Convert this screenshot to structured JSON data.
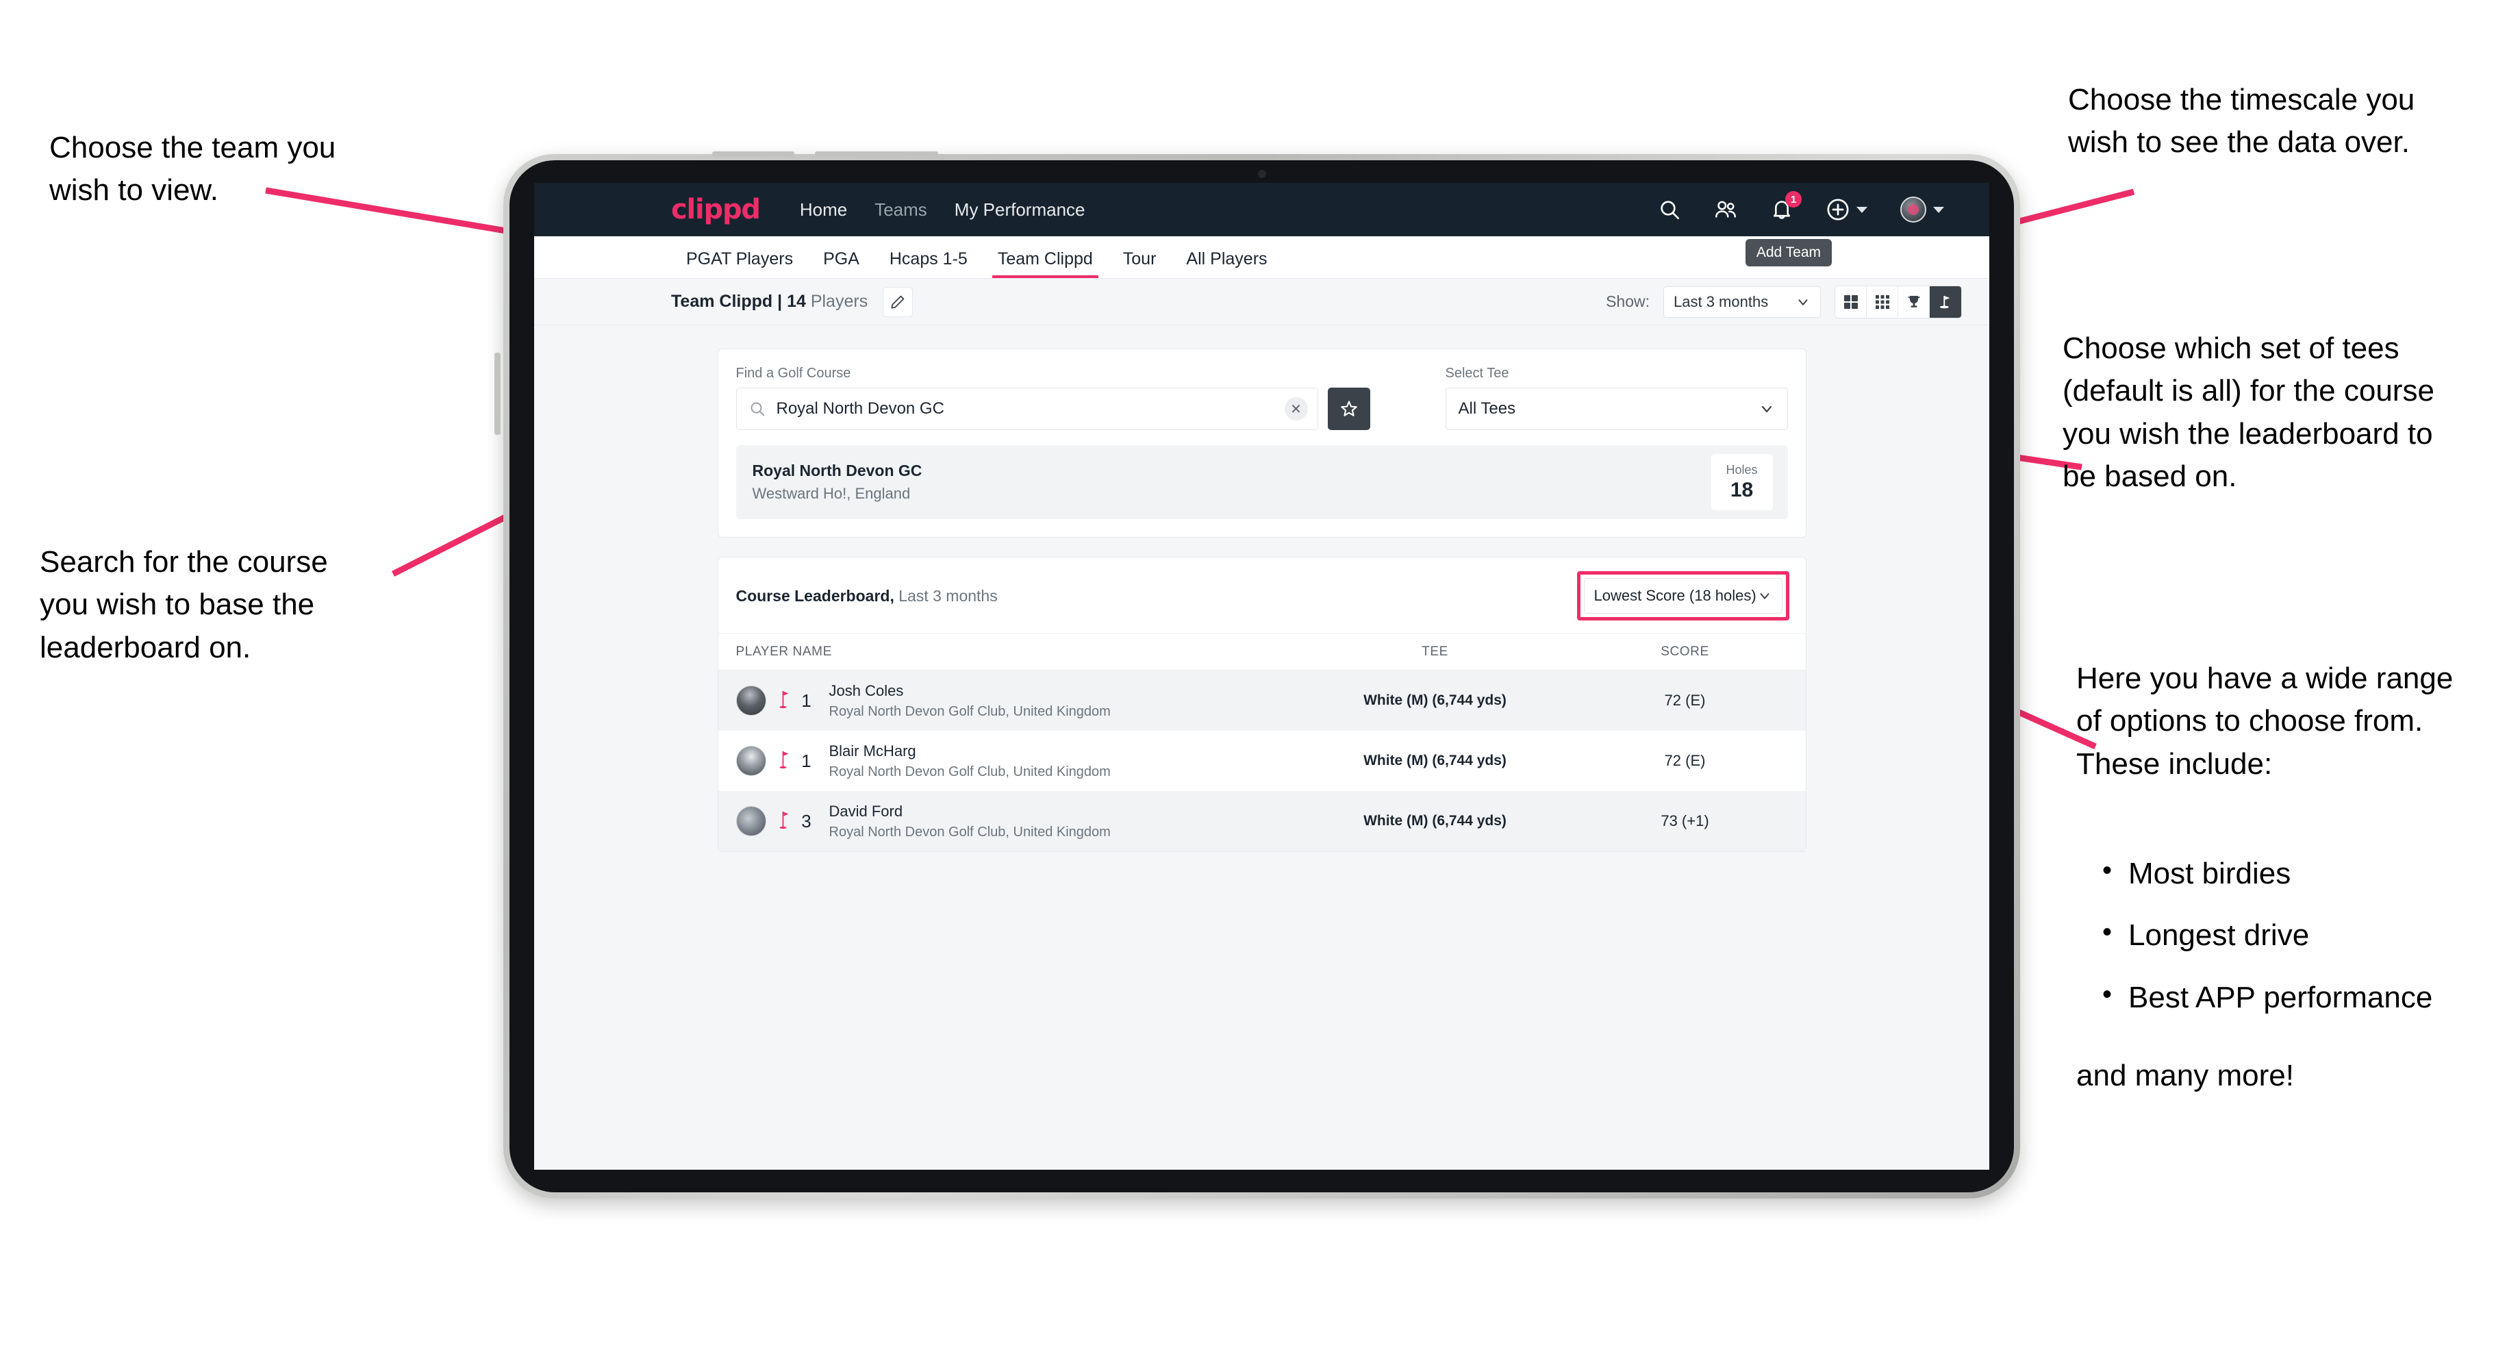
{
  "annotations": {
    "team": "Choose the team you\nwish to view.",
    "search": "Search for the course\nyou wish to base the\nleaderboard on.",
    "timescale": "Choose the timescale you\nwish to see the data over.",
    "tees": "Choose which set of tees\n(default is all) for the course\nyou wish the leaderboard to\nbe based on.",
    "options_intro": "Here you have a wide range\nof options to choose from.\nThese include:",
    "options_list": [
      "Most birdies",
      "Longest drive",
      "Best APP performance"
    ],
    "options_outro": "and many more!"
  },
  "app": {
    "navbar": {
      "brand": "clippd",
      "links": [
        {
          "label": "Home",
          "state": "active"
        },
        {
          "label": "Teams",
          "state": "dim"
        },
        {
          "label": "My Performance",
          "state": "active"
        }
      ],
      "icons": [
        {
          "name": "search-icon"
        },
        {
          "name": "people-icon"
        },
        {
          "name": "bell-icon",
          "badge": "1"
        },
        {
          "name": "plus-circle-icon"
        },
        {
          "name": "avatar-icon"
        }
      ]
    },
    "tabs": [
      {
        "label": "PGAT Players",
        "state": "normal"
      },
      {
        "label": "PGA",
        "state": "normal"
      },
      {
        "label": "Hcaps 1-5",
        "state": "normal"
      },
      {
        "label": "Team Clippd",
        "state": "active"
      },
      {
        "label": "Tour",
        "state": "normal"
      },
      {
        "label": "All Players",
        "state": "normal"
      }
    ],
    "tooltip": "Add Team",
    "toolbar": {
      "team_name": "Team Clippd",
      "separator": "|",
      "player_count": "14",
      "players_word": "Players",
      "edit_icon": "pencil-icon",
      "show_label": "Show:",
      "timescale_value": "Last 3 months",
      "view_buttons": [
        {
          "name": "grid-2x2-icon",
          "active": false
        },
        {
          "name": "grid-3x3-icon",
          "active": false
        },
        {
          "name": "trophy-icon",
          "active": false
        },
        {
          "name": "golf-flag-icon",
          "active": true
        }
      ]
    },
    "search_card": {
      "course_label": "Find a Golf Course",
      "course_value": "Royal North Devon GC",
      "course_placeholder": "Find a Golf Course",
      "clear_icon": "close-icon",
      "star_icon": "star-icon",
      "tee_label": "Select Tee",
      "tee_value": "All Tees"
    },
    "course_result": {
      "name": "Royal North Devon GC",
      "location": "Westward Ho!, England",
      "holes_label": "Holes",
      "holes_value": "18"
    },
    "leaderboard": {
      "title": "Course Leaderboard,",
      "subtitle": " Last 3 months",
      "metric_value": "Lowest Score (18 holes)",
      "columns": [
        "PLAYER NAME",
        "TEE",
        "SCORE"
      ],
      "rows": [
        {
          "rank": "1",
          "name": "Josh Coles",
          "club": "Royal North Devon Golf Club, United Kingdom",
          "tee": "White (M) (6,744 yds)",
          "score": "72 (E)"
        },
        {
          "rank": "1",
          "name": "Blair McHarg",
          "club": "Royal North Devon Golf Club, United Kingdom",
          "tee": "White (M) (6,744 yds)",
          "score": "72 (E)"
        },
        {
          "rank": "3",
          "name": "David Ford",
          "club": "Royal North Devon Golf Club, United Kingdom",
          "tee": "White (M) (6,744 yds)",
          "score": "73 (+1)"
        }
      ]
    }
  },
  "colors": {
    "accent": "#ee2d68",
    "navbar": "#16232e",
    "page_bg": "#f5f6f8",
    "dark_btn": "#3b4249"
  }
}
